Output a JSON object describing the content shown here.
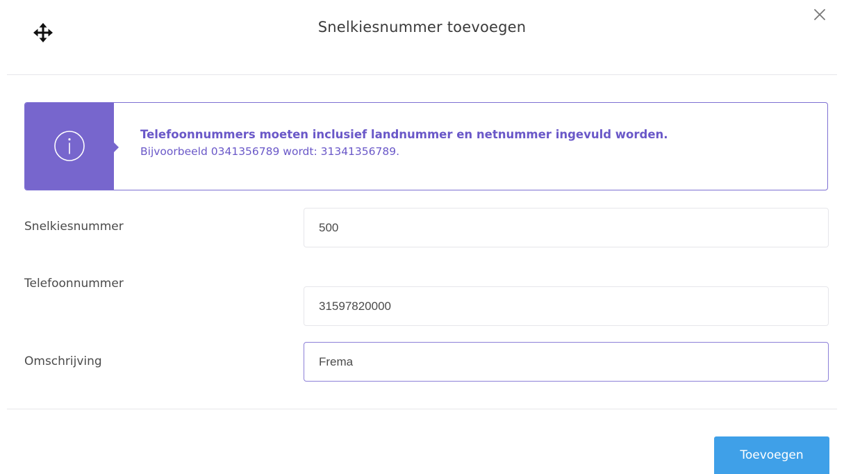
{
  "dialog": {
    "title": "Snelkiesnummer toevoegen",
    "move_icon": "move-arrows-icon",
    "close_icon": "close-x-icon"
  },
  "alert": {
    "icon": "info-circle-icon",
    "heading": "Telefoonnummers moeten inclusief landnummer en netnummer ingevuld worden.",
    "body": "Bijvoorbeeld 0341356789 wordt: 31341356789.",
    "accent_color": "#7766cd"
  },
  "form": {
    "fields": [
      {
        "label": "Snelkiesnummer",
        "value": "500"
      },
      {
        "label": "Telefoonnummer",
        "value": "31597820000"
      },
      {
        "label": "Omschrijving",
        "value": "Frema",
        "focused": true
      }
    ]
  },
  "footer": {
    "submit_label": "Toevoegen",
    "submit_color": "#3fa0e8"
  }
}
